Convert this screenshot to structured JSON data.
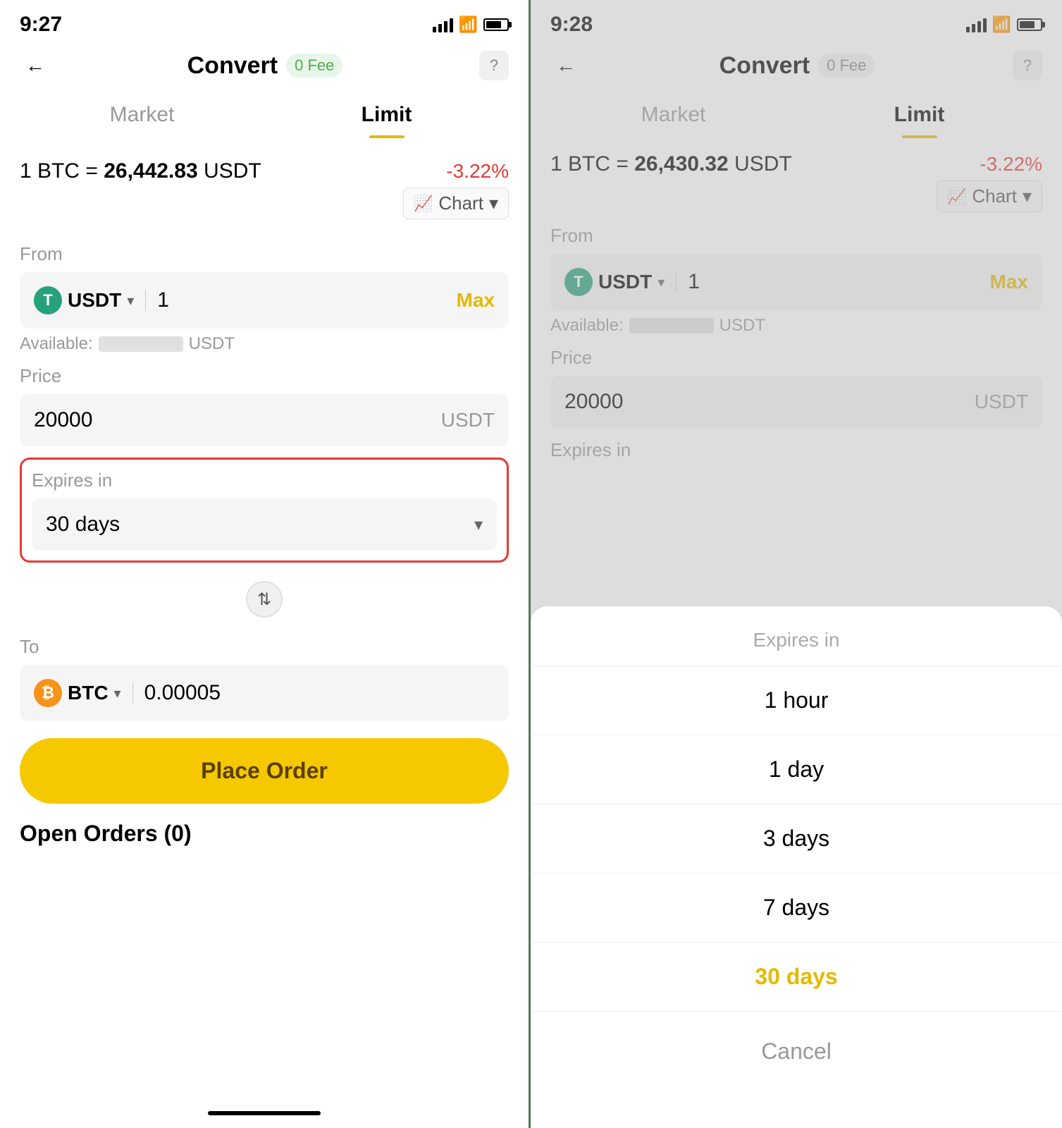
{
  "left": {
    "time": "9:27",
    "header": {
      "title": "Convert",
      "fee": "0 Fee",
      "help": "?"
    },
    "tabs": [
      {
        "label": "Market",
        "active": false
      },
      {
        "label": "Limit",
        "active": true
      }
    ],
    "rate": {
      "prefix": "1 BTC =",
      "value": "26,442.83",
      "currency": "USDT",
      "change": "-3.22%"
    },
    "chart_btn": "Chart",
    "from_label": "From",
    "from_currency": "USDT",
    "from_amount": "1",
    "from_max": "Max",
    "available_label": "Available:",
    "available_currency": "USDT",
    "price_label": "Price",
    "price_value": "20000",
    "price_currency": "USDT",
    "expires_label": "Expires in",
    "expires_value": "30 days",
    "to_label": "To",
    "to_currency": "BTC",
    "to_amount": "0.00005",
    "place_order": "Place Order",
    "open_orders": "Open Orders (0)"
  },
  "right": {
    "time": "9:28",
    "header": {
      "title": "Convert",
      "fee": "0 Fee",
      "help": "?"
    },
    "tabs": [
      {
        "label": "Market",
        "active": false
      },
      {
        "label": "Limit",
        "active": true
      }
    ],
    "rate": {
      "prefix": "1 BTC =",
      "value": "26,430.32",
      "currency": "USDT",
      "change": "-3.22%"
    },
    "chart_btn": "Chart",
    "from_label": "From",
    "from_currency": "USDT",
    "from_amount": "1",
    "from_max": "Max",
    "available_label": "Available:",
    "available_currency": "USDT",
    "price_label": "Price",
    "price_value": "20000",
    "price_currency": "USDT",
    "expires_label": "Expires in",
    "sheet": {
      "title": "Expires in",
      "options": [
        {
          "label": "1 hour",
          "selected": false
        },
        {
          "label": "1 day",
          "selected": false
        },
        {
          "label": "3 days",
          "selected": false
        },
        {
          "label": "7 days",
          "selected": false
        },
        {
          "label": "30 days",
          "selected": true
        },
        {
          "label": "Cancel",
          "cancel": true
        }
      ]
    }
  }
}
